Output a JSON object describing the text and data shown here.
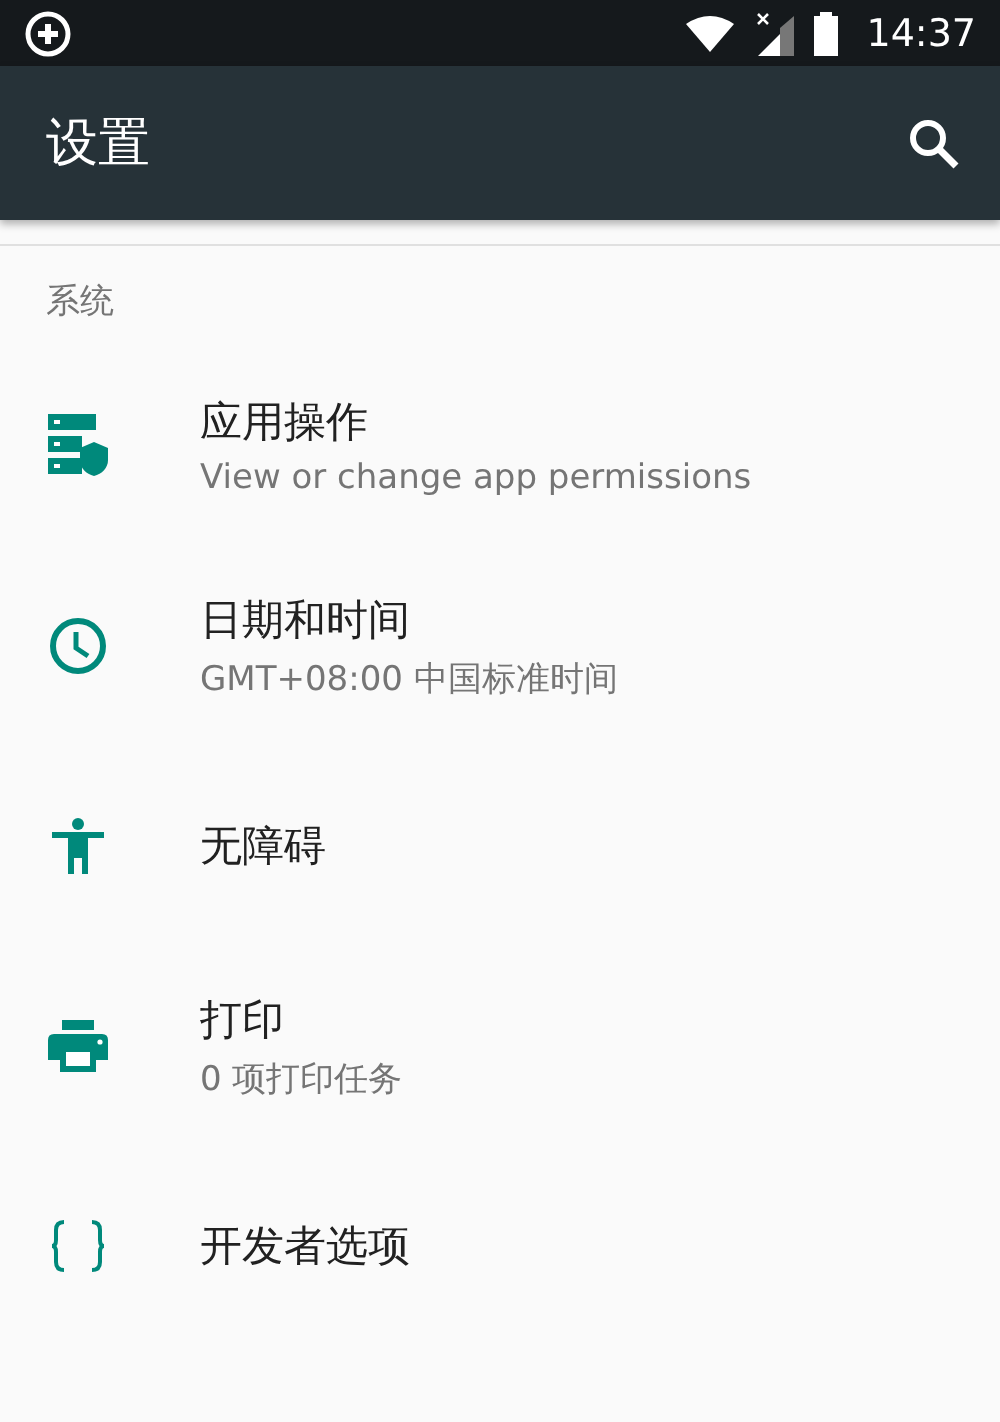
{
  "status_bar": {
    "time": "14:37"
  },
  "toolbar": {
    "title": "设置"
  },
  "section": {
    "title": "系统"
  },
  "items": [
    {
      "title": "应用操作",
      "subtitle": "View or change app permissions"
    },
    {
      "title": "日期和时间",
      "subtitle": "GMT+08:00 中国标准时间"
    },
    {
      "title": "无障碍"
    },
    {
      "title": "打印",
      "subtitle": "0 项打印任务"
    },
    {
      "title": "开发者选项"
    }
  ]
}
